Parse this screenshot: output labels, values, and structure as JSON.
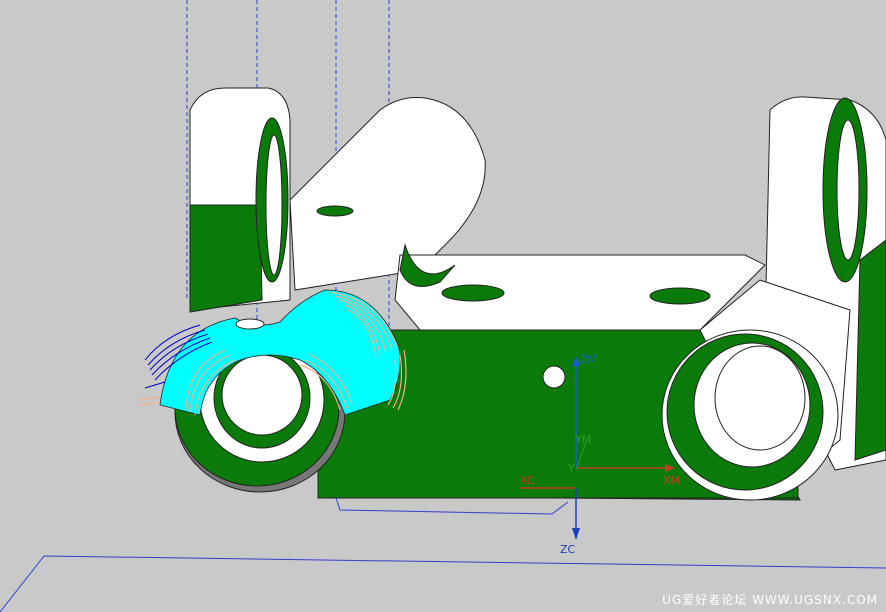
{
  "scene": {
    "background_color": "#c9c9c9",
    "part_color_white": "#ffffff",
    "part_color_green": "#0a7a0a",
    "selected_face_color": "#00ffff",
    "toolpath_color": "#f0b090",
    "wire_color": "#0000cc"
  },
  "axes": {
    "wcs_labels": {
      "zm": "ZM",
      "ym": "YM",
      "xm": "XM",
      "xc": "XC",
      "zc": "ZC",
      "yc": "Y"
    },
    "colors": {
      "zm": "#1a5fd0",
      "ym": "#2aa02a",
      "xm": "#c04020",
      "xc": "#c03a20",
      "zc": "#1a40c0"
    }
  },
  "watermark": "UG爱好者论坛 WWW.UGSNX.COM"
}
